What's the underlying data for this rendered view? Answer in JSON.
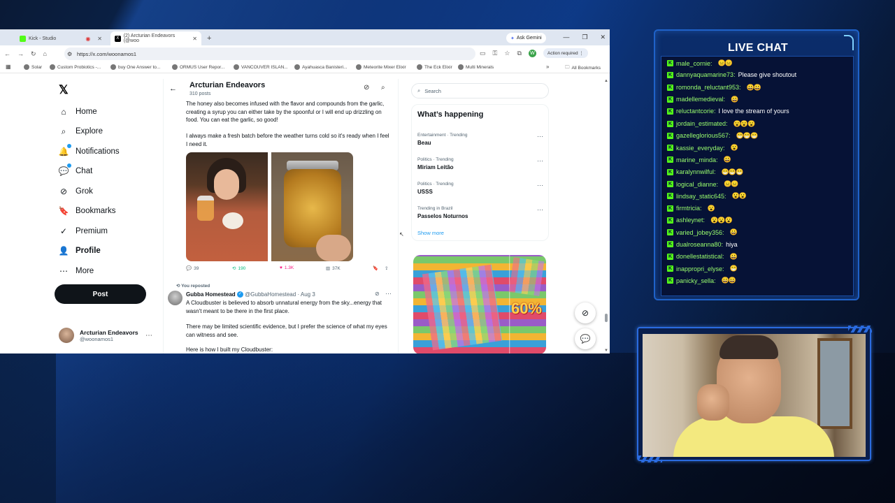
{
  "browser": {
    "tabs": [
      {
        "label": "Kick - Studio",
        "color": "#53fc18",
        "recording": true
      },
      {
        "label": "(2) Arcturian Endeavors (@woo",
        "color": "#000000"
      }
    ],
    "new_tab": "+",
    "gemini_label": "Ask Gemini",
    "url": "https://x.com/woonamos1",
    "profile_initial": "W",
    "action_required": "Action required",
    "bookmarks": [
      "Solar",
      "Custom Probiotics -...",
      "buy One Answer to...",
      "ORMUS User Repor...",
      "VANCOUVER ISLAN...",
      "Ayahuasca Banisteri...",
      "Meteorite Mixer Elixir",
      "The Eck Elixir",
      "Multi Minerals"
    ],
    "all_bookmarks": "All Bookmarks"
  },
  "x": {
    "logo": "𝕏",
    "nav": [
      {
        "label": "Home",
        "icon": "home-icon",
        "glyph": "⌂"
      },
      {
        "label": "Explore",
        "icon": "search-icon",
        "glyph": "⌕"
      },
      {
        "label": "Notifications",
        "icon": "bell-icon",
        "glyph": "🔔"
      },
      {
        "label": "Chat",
        "icon": "chat-icon",
        "glyph": "💬"
      },
      {
        "label": "Grok",
        "icon": "grok-icon",
        "glyph": "⊘"
      },
      {
        "label": "Bookmarks",
        "icon": "bookmark-icon",
        "glyph": "🔖"
      },
      {
        "label": "Premium",
        "icon": "premium-icon",
        "glyph": "✓"
      },
      {
        "label": "Profile",
        "icon": "profile-icon",
        "glyph": "👤"
      },
      {
        "label": "More",
        "icon": "more-icon",
        "glyph": "⋯"
      }
    ],
    "post_button": "Post",
    "account": {
      "name": "Arcturian Endeavors",
      "handle": "@woonamos1"
    }
  },
  "timeline": {
    "title": "Arcturian Endeavors",
    "posts_count": "310 posts",
    "tweet1": {
      "text1": "The honey also becomes infused with the flavor and compounds from the garlic, creating a syrup you can either take by the spoonful or I will end up drizzling on food. You can eat the garlic, so good!",
      "text2": "I always make a fresh batch before the weather turns cold so it's ready when I feel I need it.",
      "replies": "39",
      "reposts": "190",
      "likes": "1.3K",
      "views": "37K"
    },
    "repost_label": "You reposted",
    "tweet2": {
      "author": "Gubba Homestead",
      "handle": "@GubbaHomestead",
      "date": "· Aug 3",
      "text1": "A Cloudbuster is believed to absorb unnatural energy from the sky...energy that wasn't meant to be there in the first place.",
      "text2": "There may be limited scientific evidence, but I prefer the science of what my eyes can witness and see.",
      "text3": "Here is how I built my Cloudbuster:"
    }
  },
  "sidebar": {
    "search_placeholder": "Search",
    "trending_title": "What’s happening",
    "trends": [
      {
        "category": "Entertainment · Trending",
        "name": "Beau"
      },
      {
        "category": "Politics · Trending",
        "name": "Miriam Leitão"
      },
      {
        "category": "Politics · Trending",
        "name": "USSS"
      },
      {
        "category": "Trending in Brazil",
        "name": "Passelos Noturnos"
      }
    ],
    "show_more": "Show more",
    "ad_text": "60%"
  },
  "chat": {
    "title": "LIVE CHAT",
    "messages": [
      {
        "user": "male_cornie:",
        "text": "",
        "emotes": "😑😑"
      },
      {
        "user": "dannyaquamarine73:",
        "text": "Please give shoutout",
        "emotes": ""
      },
      {
        "user": "romonda_reluctant953:",
        "text": "",
        "emotes": "😀😀"
      },
      {
        "user": "madellemedieval:",
        "text": "",
        "emotes": "😀"
      },
      {
        "user": "reluctantcorie:",
        "text": "I love the stream of yours",
        "emotes": ""
      },
      {
        "user": "jordain_estimated:",
        "text": "",
        "emotes": "😮😮😮"
      },
      {
        "user": "gazelleglorious567:",
        "text": "",
        "emotes": "😁😁😁"
      },
      {
        "user": "kassie_everyday:",
        "text": "",
        "emotes": "😮"
      },
      {
        "user": "marine_minda:",
        "text": "",
        "emotes": "😀"
      },
      {
        "user": "karalynnwilful:",
        "text": "",
        "emotes": "😁😁😁"
      },
      {
        "user": "logical_dianne:",
        "text": "",
        "emotes": "😑😑"
      },
      {
        "user": "lindsay_static645:",
        "text": "",
        "emotes": "😮😮"
      },
      {
        "user": "firmtricia:",
        "text": "",
        "emotes": "😮"
      },
      {
        "user": "ashleynet:",
        "text": "",
        "emotes": "😮😮😮"
      },
      {
        "user": "varied_jobey356:",
        "text": "",
        "emotes": "😀"
      },
      {
        "user": "dualroseanna80:",
        "text": "hiya",
        "emotes": ""
      },
      {
        "user": "donellestatistical:",
        "text": "",
        "emotes": "😀"
      },
      {
        "user": "inappropri_elyse:",
        "text": "",
        "emotes": "😁"
      },
      {
        "user": "panicky_sella:",
        "text": "",
        "emotes": "😀😀"
      }
    ]
  },
  "colors": {
    "kick_green": "#53fc18",
    "x_blue": "#1d9bf0",
    "like_pink": "#f91880",
    "repost_green": "#00ba7c"
  }
}
